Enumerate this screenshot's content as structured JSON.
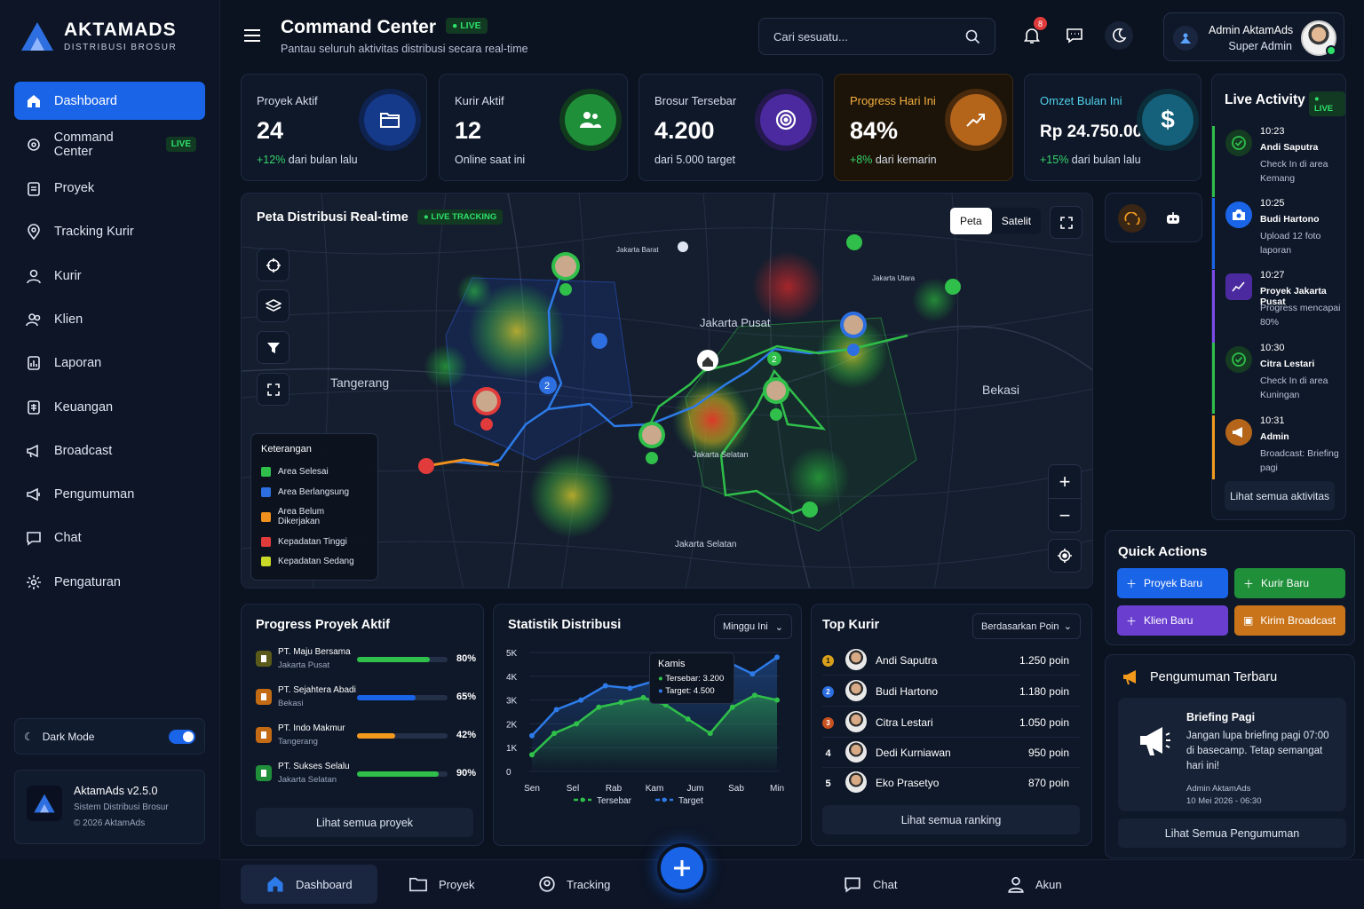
{
  "brand": {
    "name": "AKTAMADS",
    "tagline": "DISTRIBUSI BROSUR"
  },
  "colors": {
    "accent": "#1a64e8",
    "live": "#2ee06a",
    "success": "#36d46b",
    "warning": "#f39a1d",
    "danger": "#e23b3b",
    "purple": "#7b4be8"
  },
  "sidebar": {
    "items": [
      {
        "label": "Dashboard",
        "icon": "home-icon",
        "active": true
      },
      {
        "label": "Command Center",
        "icon": "command-icon",
        "badge": "LIVE"
      },
      {
        "label": "Proyek",
        "icon": "clipboard-icon"
      },
      {
        "label": "Tracking Kurir",
        "icon": "location-icon"
      },
      {
        "label": "Kurir",
        "icon": "user-icon"
      },
      {
        "label": "Klien",
        "icon": "users-icon"
      },
      {
        "label": "Laporan",
        "icon": "report-icon"
      },
      {
        "label": "Keuangan",
        "icon": "finance-icon"
      },
      {
        "label": "Broadcast",
        "icon": "megaphone-icon"
      },
      {
        "label": "Pengumuman",
        "icon": "announcement-icon"
      },
      {
        "label": "Chat",
        "icon": "chat-icon"
      },
      {
        "label": "Pengaturan",
        "icon": "gear-icon"
      }
    ],
    "dark_mode_label": "Dark Mode",
    "version": {
      "title": "AktamAds v2.5.0",
      "subtitle": "Sistem Distribusi Brosur",
      "copyright": "© 2026 AktamAds"
    }
  },
  "header": {
    "title": "Command Center",
    "live": "LIVE",
    "subtitle": "Pantau seluruh aktivitas distribusi secara real-time",
    "search_placeholder": "Cari sesuatu...",
    "notification_count": "8",
    "user": {
      "name": "Admin AktamAds",
      "role": "Super Admin"
    }
  },
  "stats": [
    {
      "label": "Proyek Aktif",
      "value": "24",
      "delta": "+12%",
      "note": " dari bulan lalu",
      "icon": "folder-icon"
    },
    {
      "label": "Kurir Aktif",
      "value": "12",
      "delta": "",
      "note": "Online saat ini",
      "icon": "users-icon"
    },
    {
      "label": "Brosur Tersebar",
      "value": "4.200",
      "delta": "",
      "note": "dari 5.000 target",
      "icon": "target-icon"
    },
    {
      "label": "Progress Hari Ini",
      "value": "84%",
      "delta": "+8%",
      "note": " dari kemarin",
      "icon": "trend-icon"
    },
    {
      "label": "Omzet Bulan Ini",
      "value": "Rp 24.750.000",
      "delta": "+15%",
      "note": " dari bulan lalu",
      "icon": "dollar-icon"
    }
  ],
  "map": {
    "title": "Peta Distribusi Real-time",
    "live": "LIVE TRACKING",
    "tabs": [
      "Peta",
      "Satelit"
    ],
    "places": [
      "Tangerang",
      "Jakarta Pusat",
      "Bekasi",
      "Jakarta Barat",
      "Jakarta Selatan",
      "Jakarta Utara"
    ],
    "legend_title": "Keterangan",
    "legend": [
      {
        "label": "Area Selesai",
        "color": "#2fbf4a"
      },
      {
        "label": "Area Berlangsung",
        "color": "#2d6fe0"
      },
      {
        "label": "Area Belum Dikerjakan",
        "color": "#f0901d"
      },
      {
        "label": "Kepadatan Tinggi",
        "color": "#e23b3b"
      },
      {
        "label": "Kepadatan Sedang",
        "color": "#c8d928"
      }
    ],
    "cluster_labels": [
      "2",
      "2"
    ]
  },
  "live_activity": {
    "title": "Live Activity",
    "live": "LIVE",
    "items": [
      {
        "time": "10:23",
        "name": "Andi Saputra",
        "desc": "Check In di area Kemang",
        "color": "#2fbf4a",
        "icon": "check-icon"
      },
      {
        "time": "10:25",
        "name": "Budi Hartono",
        "desc": "Upload 12 foto laporan",
        "color": "#1a64e8",
        "icon": "camera-icon"
      },
      {
        "time": "10:27",
        "name": "Proyek Jakarta Pusat",
        "desc": "Progress mencapai 80%",
        "color": "#7b4be8",
        "icon": "chart-icon"
      },
      {
        "time": "10:30",
        "name": "Citra Lestari",
        "desc": "Check In di area Kuningan",
        "color": "#2fbf4a",
        "icon": "check-icon"
      },
      {
        "time": "10:31",
        "name": "Admin",
        "desc": "Broadcast: Briefing pagi",
        "color": "#f39a1d",
        "icon": "megaphone-icon"
      }
    ],
    "view_all": "Lihat semua aktivitas"
  },
  "quick_actions": {
    "title": "Quick Actions",
    "buttons": [
      {
        "label": "Proyek Baru",
        "color": "#1a64e8"
      },
      {
        "label": "Kurir Baru",
        "color": "#1f8f3a"
      },
      {
        "label": "Klien Baru",
        "color": "#6a3fd0"
      },
      {
        "label": "Kirim Broadcast",
        "color": "#c9741a"
      }
    ]
  },
  "announcement": {
    "title": "Pengumuman Terbaru",
    "heading": "Briefing Pagi",
    "text": "Jangan lupa briefing pagi 07:00 di basecamp. Tetap semangat hari ini!",
    "author": "Admin AktamAds",
    "date": "10 Mei 2026 - 06:30",
    "view_all": "Lihat Semua Pengumuman"
  },
  "projects": {
    "title": "Progress Proyek Aktif",
    "items": [
      {
        "name": "PT. Maju Bersama",
        "loc": "Jakarta Pusat",
        "percent": 80,
        "label": "80%",
        "color": "#2fbf4a",
        "icon_bg": "#5a5a1a"
      },
      {
        "name": "PT. Sejahtera Abadi",
        "loc": "Bekasi",
        "percent": 65,
        "label": "65%",
        "color": "#1a64e8",
        "icon_bg": "#c26a14"
      },
      {
        "name": "PT. Indo Makmur",
        "loc": "Tangerang",
        "percent": 42,
        "label": "42%",
        "color": "#f39a1d",
        "icon_bg": "#c26a14"
      },
      {
        "name": "PT. Sukses Selalu",
        "loc": "Jakarta Selatan",
        "percent": 90,
        "label": "90%",
        "color": "#2fbf4a",
        "icon_bg": "#1f8f3a"
      }
    ],
    "view_all": "Lihat semua proyek"
  },
  "chart_data": {
    "type": "line",
    "title": "Statistik Distribusi",
    "period": "Minggu Ini",
    "categories": [
      "Sen",
      "Sel",
      "Rab",
      "Kam",
      "Jum",
      "Sab",
      "Min"
    ],
    "series": [
      {
        "name": "Tersebar",
        "color": "#2fbf4a",
        "values": [
          700,
          1600,
          2000,
          2700,
          2900,
          3100,
          2800,
          2200,
          1600,
          2700,
          3200,
          3000
        ]
      },
      {
        "name": "Target",
        "color": "#2d7be8",
        "values": [
          1500,
          2600,
          3000,
          3600,
          3500,
          3800,
          4400,
          4000,
          4600,
          4100,
          4800
        ]
      }
    ],
    "y_ticks": [
      "0",
      "1K",
      "2K",
      "3K",
      "4K",
      "5K"
    ],
    "ylim": [
      0,
      5000
    ],
    "tooltip": {
      "day": "Kamis",
      "tersebar": "Tersebar: 3.200",
      "target": "Target: 4.500"
    }
  },
  "top_kurir": {
    "title": "Top Kurir",
    "sort": "Berdasarkan Poin",
    "items": [
      {
        "rank": "1",
        "name": "Andi Saputra",
        "points": "1.250 poin",
        "medal": "#d9a01b"
      },
      {
        "rank": "2",
        "name": "Budi Hartono",
        "points": "1.180 poin",
        "medal": "#2d6fe0"
      },
      {
        "rank": "3",
        "name": "Citra Lestari",
        "points": "1.050 poin",
        "medal": "#c8521f"
      },
      {
        "rank": "4",
        "name": "Dedi Kurniawan",
        "points": "950 poin",
        "medal": ""
      },
      {
        "rank": "5",
        "name": "Eko Prasetyo",
        "points": "870 poin",
        "medal": ""
      }
    ],
    "view_all": "Lihat semua ranking"
  },
  "bottom_nav": [
    {
      "label": "Dashboard",
      "icon": "home-icon"
    },
    {
      "label": "Proyek",
      "icon": "folder-icon"
    },
    {
      "label": "Tracking",
      "icon": "location-icon"
    },
    {
      "label": "Chat",
      "icon": "chat-icon"
    },
    {
      "label": "Akun",
      "icon": "user-icon"
    }
  ]
}
